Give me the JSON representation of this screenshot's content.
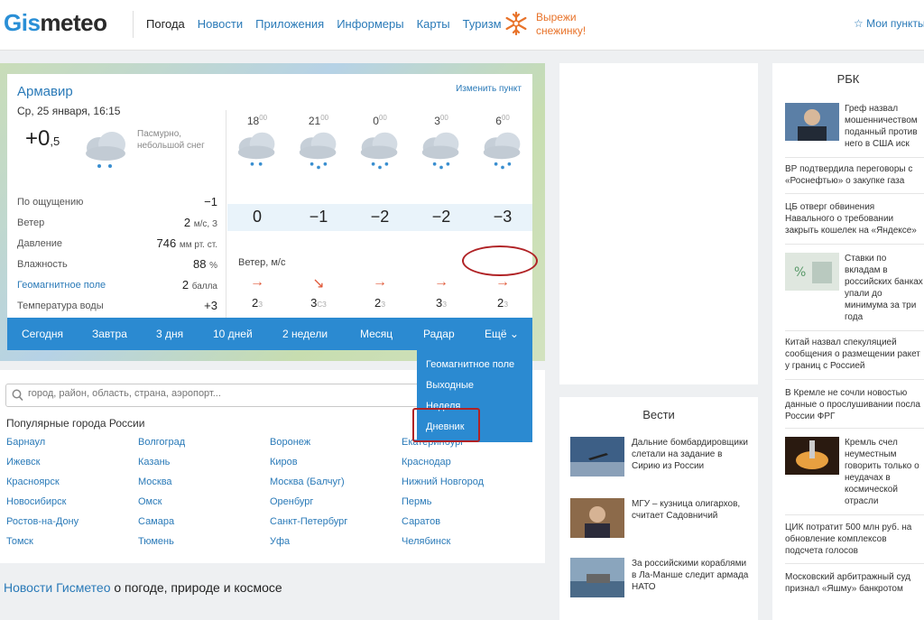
{
  "header": {
    "logo_part1": "Gis",
    "logo_part2": "meteo",
    "nav": [
      {
        "label": "Погода",
        "active": true
      },
      {
        "label": "Новости"
      },
      {
        "label": "Приложения"
      },
      {
        "label": "Информеры"
      },
      {
        "label": "Карты"
      },
      {
        "label": "Туризм"
      }
    ],
    "promo_line1": "Вырежи",
    "promo_line2": "снежинку!",
    "my_points": "☆ Мои пункты"
  },
  "weather": {
    "city": "Армавир",
    "change_point": "Изменить пункт",
    "date": "Ср, 25 января, 16:15",
    "temp_main": "+0",
    "temp_decimal": ",5",
    "condition_line1": "Пасмурно,",
    "condition_line2": "небольшой снег",
    "params": [
      {
        "label": "По ощущению",
        "value": "−1",
        "unit": ""
      },
      {
        "label": "Ветер",
        "value": "2",
        "unit": "м/с, З"
      },
      {
        "label": "Давление",
        "value": "746",
        "unit": "мм рт. ст."
      },
      {
        "label": "Влажность",
        "value": "88",
        "unit": "%"
      },
      {
        "label": "Геомагнитное поле",
        "value": "2",
        "unit": "балла",
        "link": true
      },
      {
        "label": "Температура воды",
        "value": "+3",
        "unit": ""
      }
    ],
    "forecast": [
      {
        "hour": "18",
        "min": "00",
        "temp": "0",
        "wind": "2",
        "dir": "З"
      },
      {
        "hour": "21",
        "min": "00",
        "temp": "−1",
        "wind": "3",
        "dir": "СЗ"
      },
      {
        "hour": "0",
        "min": "00",
        "temp": "−2",
        "wind": "2",
        "dir": "З"
      },
      {
        "hour": "3",
        "min": "00",
        "temp": "−2",
        "wind": "3",
        "dir": "З"
      },
      {
        "hour": "6",
        "min": "00",
        "temp": "−3",
        "wind": "2",
        "dir": "З"
      }
    ],
    "wind_label": "Ветер, м/с",
    "tabs": [
      "Сегодня",
      "Завтра",
      "3 дня",
      "10 дней",
      "2 недели",
      "Месяц",
      "Радар"
    ],
    "more_label": "Ещё ⌄",
    "dropdown": [
      "Геомагнитное поле",
      "Выходные",
      "Неделя",
      "Дневник"
    ]
  },
  "search": {
    "placeholder": "город, район, область, страна, аэропорт..."
  },
  "popular": {
    "title": "Популярные города России",
    "cities": [
      "Барнаул",
      "Волгоград",
      "Воронеж",
      "Екатеринбург",
      "Ижевск",
      "Казань",
      "Киров",
      "Краснодар",
      "Красноярск",
      "Москва",
      "Москва (Балчуг)",
      "Нижний Новгород",
      "Новосибирск",
      "Омск",
      "Оренбург",
      "Пермь",
      "Ростов-на-Дону",
      "Самара",
      "Санкт-Петербург",
      "Саратов",
      "Томск",
      "Тюмень",
      "Уфа",
      "Челябинск"
    ]
  },
  "news_footer": {
    "link": "Новости Гисметео",
    "rest": " о погоде, природе и космосе"
  },
  "vesti": {
    "title": "Вести",
    "items": [
      "Дальние бомбардировщики слетали на задание в Сирию из России",
      "МГУ – кузница олигархов, считает Садовничий",
      "За российскими кораблями в Ла-Манше следит армада НАТО"
    ]
  },
  "rbk": {
    "title": "РБК",
    "items": [
      "Греф назвал мошенничеством поданный против него в США иск",
      "ВР подтвердила переговоры с «Роснефтью» о закупке газа",
      "ЦБ отверг обвинения Навального о требовании закрыть кошелек на «Яндексе»",
      "Ставки по вкладам в российских банках упали до минимума за три года",
      "Китай назвал спекуляцией сообщения о размещении ракет у границ с Россией",
      "В Кремле не сочли новостью данные о прослушивании посла России ФРГ",
      "Кремль счел неуместным говорить только о неудачах в космической отрасли",
      "ЦИК потратит 500 млн руб. на обновление комплексов подсчета голосов",
      "Московский арбитражный суд признал «Яшму» банкротом"
    ]
  },
  "colors": {
    "brand_blue": "#2a8fd6",
    "tab_bar": "#2b8ad1",
    "highlight_red": "#b02225",
    "wind_arrow": "#e05a3a"
  }
}
